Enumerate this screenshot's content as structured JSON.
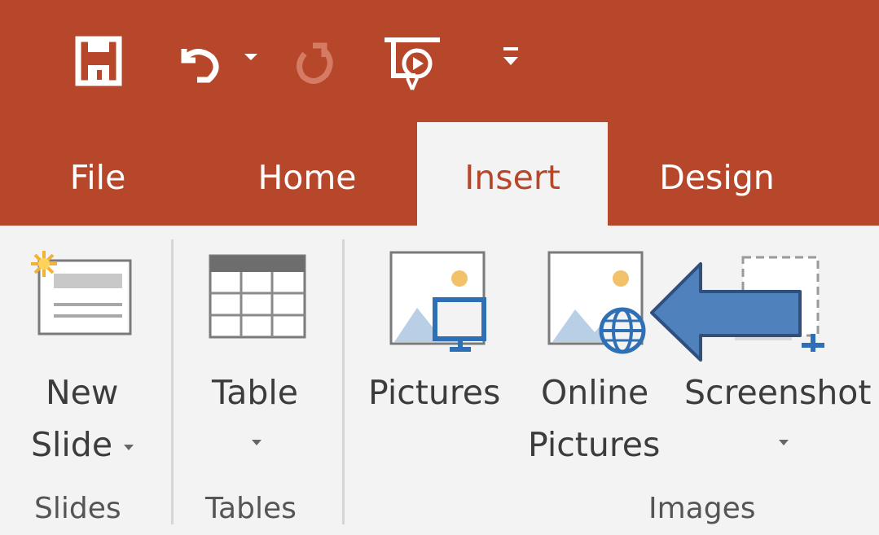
{
  "quick_access": {
    "icons": [
      "save-icon",
      "undo-icon",
      "undo-dropdown-icon",
      "redo-icon",
      "start-slideshow-icon",
      "customize-qat-icon"
    ]
  },
  "tabs": [
    {
      "label": "File"
    },
    {
      "label": "Home"
    },
    {
      "label": "Insert",
      "active": true
    },
    {
      "label": "Design"
    }
  ],
  "ribbon": {
    "new_slide": {
      "line1": "New",
      "line2": "Slide"
    },
    "table": {
      "label": "Table"
    },
    "pictures": {
      "label": "Pictures"
    },
    "online_pictures": {
      "line1": "Online",
      "line2": "Pictures"
    },
    "screenshot": {
      "label": "Screenshot"
    },
    "groups": {
      "slides": "Slides",
      "tables": "Tables",
      "images": "Images"
    }
  },
  "annotation": {
    "arrow": "blue-left-arrow-pointing-to-online-pictures"
  },
  "colors": {
    "accent": "#b7472a",
    "ribbon_bg": "#f3f3f3",
    "arrow_fill": "#4f81bd",
    "arrow_stroke": "#2f4f7f"
  }
}
